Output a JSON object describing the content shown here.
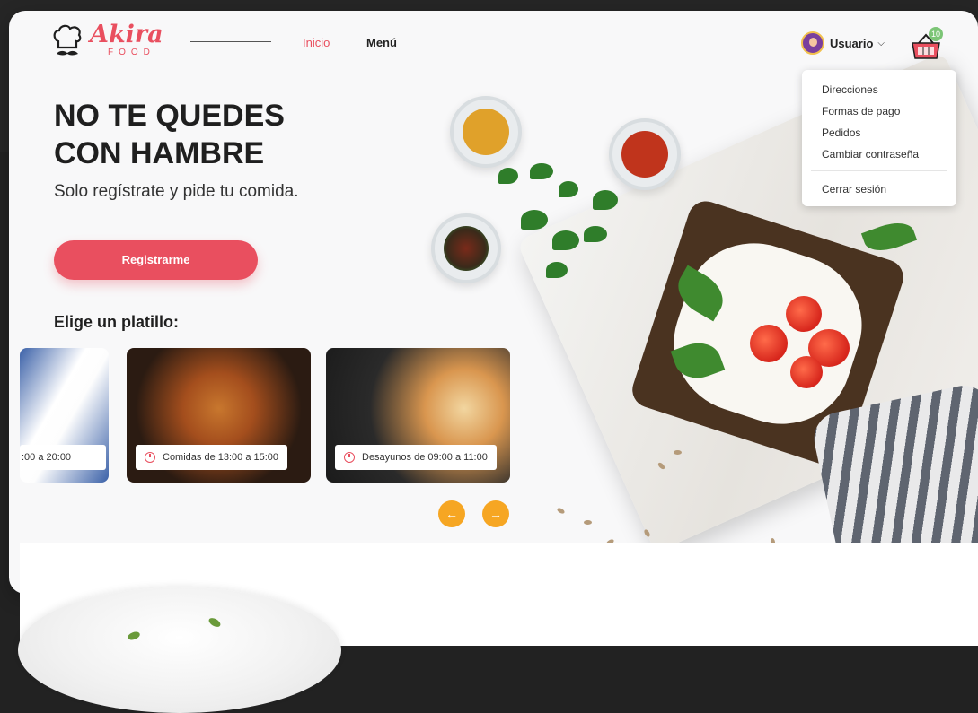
{
  "brand": {
    "name": "Akira",
    "sub": "FOOD"
  },
  "nav": {
    "inicio": "Inicio",
    "menu": "Menú"
  },
  "user": {
    "label": "Usuario",
    "cart_count": "10"
  },
  "dropdown": {
    "items": [
      "Direcciones",
      "Formas de pago",
      "Pedidos",
      "Cambiar contraseña"
    ],
    "logout": "Cerrar sesión"
  },
  "hero": {
    "title": "NO TE QUEDES CON HAMBRE",
    "subtitle": "Solo regístrate y pide tu comida.",
    "cta": "Registrarme"
  },
  "section": {
    "title": "Elige un platillo:"
  },
  "cards": [
    {
      "label": ":00 a 20:00"
    },
    {
      "label": "Comidas de 13:00 a 15:00"
    },
    {
      "label": "Desayunos de 09:00 a 11:00"
    }
  ],
  "colors": {
    "accent": "#e94f5f",
    "arrow": "#f6a623",
    "badge": "#7cc576"
  },
  "icons": {
    "logo": "chef-hat-mustache-icon",
    "cart": "basket-icon",
    "clock": "clock-icon",
    "prev": "arrow-left-icon",
    "next": "arrow-right-icon"
  }
}
